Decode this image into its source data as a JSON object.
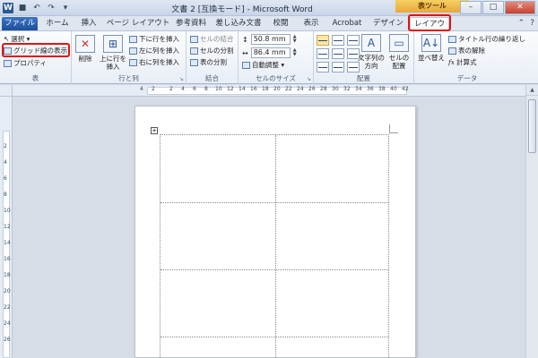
{
  "window": {
    "title": "文書 2 [互換モード] - Microsoft Word",
    "app_icon": "W",
    "tool_tab_header": "表ツール",
    "controls": {
      "minimize": "–",
      "maximize": "□",
      "close": "✕"
    },
    "qat": [
      "save-icon",
      "undo-icon",
      "redo-icon",
      "customize-icon"
    ],
    "qat_glyphs": [
      "■",
      "↶",
      "↷",
      "▾"
    ]
  },
  "tabs": [
    {
      "label": "ファイル",
      "type": "file"
    },
    {
      "label": "ホーム"
    },
    {
      "label": "挿入"
    },
    {
      "label": "ページ レイアウト"
    },
    {
      "label": "参考資料"
    },
    {
      "label": "差し込み文書"
    },
    {
      "label": "校閲"
    },
    {
      "label": "表示"
    },
    {
      "label": "Acrobat"
    },
    {
      "label": "デザイン"
    },
    {
      "label": "レイアウト",
      "active": true
    }
  ],
  "ribbon": {
    "group_table": {
      "label": "表",
      "select": "選択 ▾",
      "gridlines": "グリッド線の表示",
      "properties": "プロパティ"
    },
    "group_rows_cols": {
      "label": "行と列",
      "delete": "削除",
      "insert_above": "上に行を挿入",
      "insert_below": "下に行を挿入",
      "insert_left": "左に列を挿入",
      "insert_right": "右に列を挿入"
    },
    "group_merge": {
      "label": "結合",
      "merge_cells": "セルの結合",
      "split_cells": "セルの分割",
      "split_table": "表の分割"
    },
    "group_cell_size": {
      "label": "セルのサイズ",
      "height": "50.8 mm",
      "width": "86.4 mm",
      "autofit": "自動調整 ▾"
    },
    "group_alignment": {
      "label": "配置",
      "text_direction": "文字列の方向",
      "cell_margins": "セルの配置"
    },
    "group_data": {
      "label": "データ",
      "sort": "並べ替え",
      "repeat_header": "タイトル行の繰り返し",
      "convert_to_text": "表の解除",
      "formula": "計算式"
    }
  },
  "ruler": {
    "h_numbers": [
      "4",
      "2",
      "2",
      "4",
      "6",
      "8",
      "10",
      "12",
      "14",
      "16",
      "18",
      "20",
      "22",
      "24",
      "26",
      "28",
      "30",
      "32",
      "34",
      "36",
      "38",
      "40",
      "42"
    ],
    "v_numbers": [
      "2",
      "4",
      "6",
      "8",
      "10",
      "12",
      "14",
      "16",
      "18",
      "20",
      "22",
      "24",
      "26"
    ]
  },
  "document": {
    "rows": 4,
    "cols": 2
  }
}
